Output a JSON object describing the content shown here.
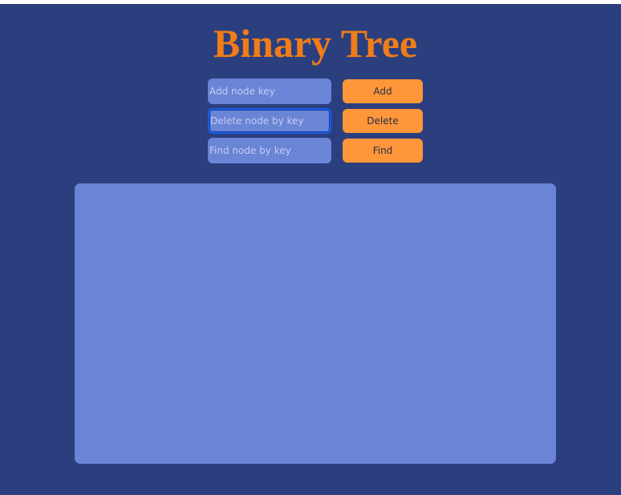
{
  "page": {
    "title": "Binary Tree"
  },
  "controls": {
    "add": {
      "placeholder": "Add node key",
      "button_label": "Add"
    },
    "delete": {
      "placeholder": "Delete node by key",
      "button_label": "Delete"
    },
    "find": {
      "placeholder": "Find node by key",
      "button_label": "Find"
    }
  },
  "colors": {
    "background": "#2b3f7e",
    "title": "#f07d18",
    "input": "#6a84d6",
    "button": "#ff963a",
    "canvas": "#6b84d6",
    "focus_ring": "#1a5fe6"
  }
}
